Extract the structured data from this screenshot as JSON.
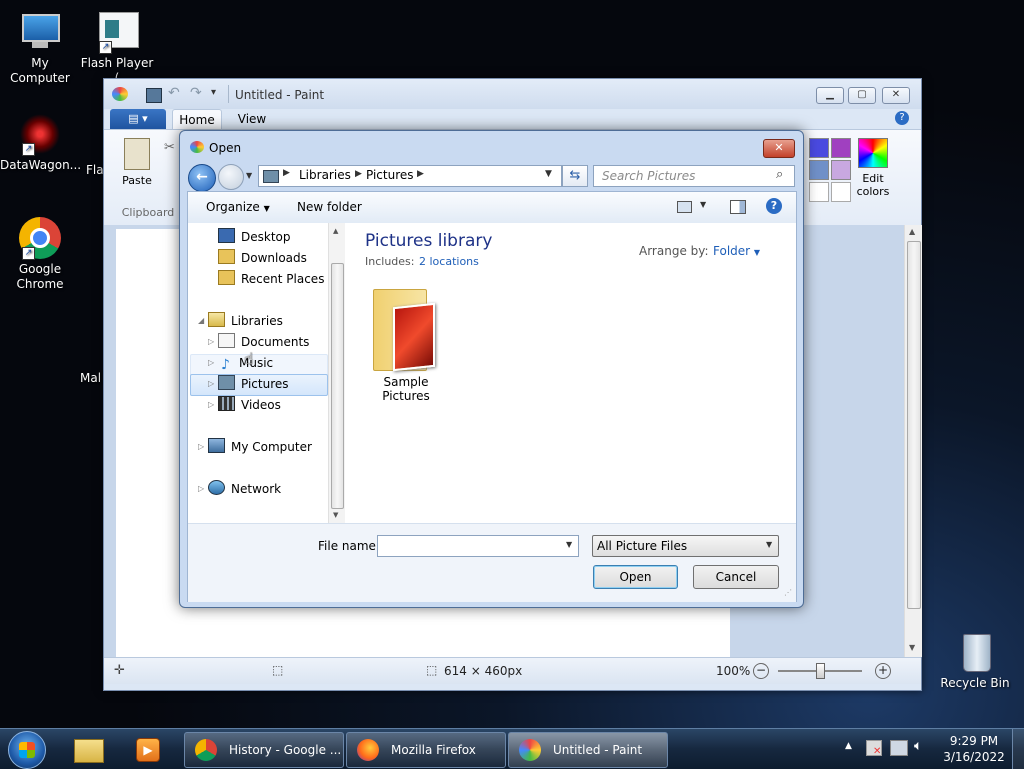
{
  "desktop": {
    "icons": [
      {
        "label": "My Computer"
      },
      {
        "label": "Flash Player"
      },
      {
        "label": "DataWagon..."
      },
      {
        "label": "Google Chrome"
      },
      {
        "label": "Recycle Bin"
      }
    ],
    "partial_labels": {
      "flash_sub": "(",
      "fla2": "Fla",
      "mal": "Mal"
    }
  },
  "paint": {
    "title": "Untitled - Paint",
    "tabs": [
      "Home",
      "View"
    ],
    "paste_label": "Paste",
    "clipboard_group": "Clipboard",
    "edit_colors": "Edit colors",
    "status": {
      "size": "614 × 460px",
      "zoom": "100%"
    }
  },
  "dialog": {
    "title": "Open",
    "breadcrumb": [
      "Libraries",
      "Pictures"
    ],
    "search_placeholder": "Search Pictures",
    "organize": "Organize",
    "new_folder": "New folder",
    "nav": {
      "favorites": [
        "Desktop",
        "Downloads",
        "Recent Places"
      ],
      "libraries": "Libraries",
      "library_items": [
        "Documents",
        "Music",
        "Pictures",
        "Videos"
      ],
      "computer": "My Computer",
      "network": "Network"
    },
    "library_title": "Pictures library",
    "includes_label": "Includes:",
    "includes_link": "2 locations",
    "arrange_label": "Arrange by:",
    "arrange_value": "Folder",
    "folder_name": "Sample Pictures",
    "filename_label": "File name:",
    "filename_value": "",
    "filetype": "All Picture Files",
    "open_button": "Open",
    "cancel_button": "Cancel"
  },
  "taskbar": {
    "items": [
      {
        "label": "History - Google ..."
      },
      {
        "label": "Mozilla Firefox"
      },
      {
        "label": "Untitled - Paint"
      }
    ],
    "time": "9:29 PM",
    "date": "3/16/2022"
  },
  "colors": {
    "accent": "#1f5fb8",
    "titlebar": "#c9daf1",
    "taskbar": "#16283f"
  }
}
